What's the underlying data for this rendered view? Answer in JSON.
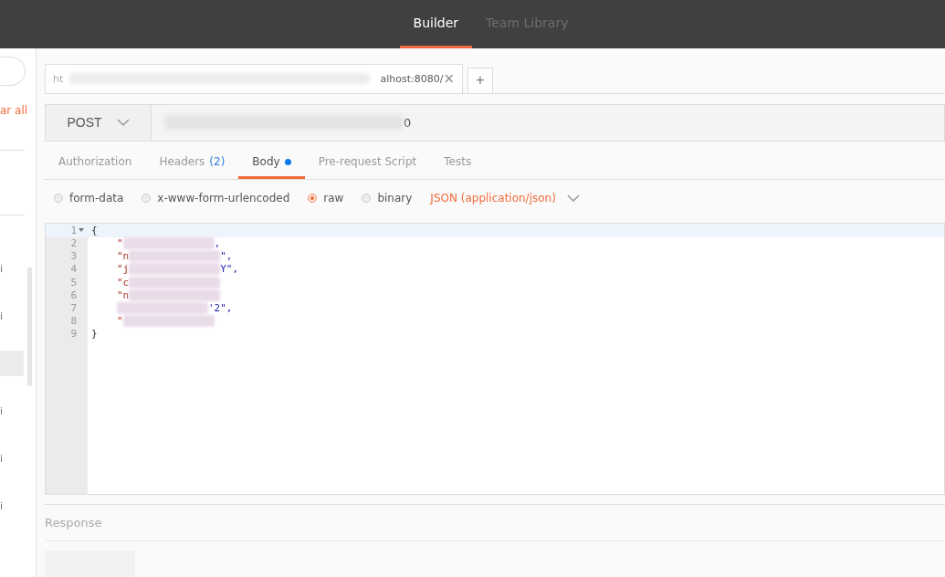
{
  "header": {
    "tabs": [
      {
        "label": "Builder",
        "selected": true
      },
      {
        "label": "Team Library",
        "selected": false
      }
    ]
  },
  "sidebar": {
    "clear_link": "ar all",
    "items": [
      {
        "label": "i",
        "selected": false
      },
      {
        "label": "i",
        "selected": false
      },
      {
        "selected": true
      },
      {
        "label": "i",
        "selected": false
      },
      {
        "label": "i",
        "selected": false
      },
      {
        "label": "i",
        "selected": false
      }
    ]
  },
  "request_tabs": [
    {
      "head": "ht",
      "tail": "alhost:8080/",
      "close": "×",
      "selected": true
    }
  ],
  "new_tab": "+",
  "request": {
    "method": "POST",
    "url_tail": "0"
  },
  "sub_tabs": [
    {
      "label": "Authorization",
      "selected": false
    },
    {
      "label": "Headers",
      "count": "(2)",
      "selected": false
    },
    {
      "label": "Body",
      "dot": true,
      "selected": true
    },
    {
      "label": "Pre-request Script",
      "selected": false
    },
    {
      "label": "Tests",
      "selected": false
    }
  ],
  "body_modes": [
    {
      "label": "form-data",
      "selected": false
    },
    {
      "label": "x-www-form-urlencoded",
      "selected": false
    },
    {
      "label": "raw",
      "selected": true
    },
    {
      "label": "binary",
      "selected": false
    }
  ],
  "content_type": "JSON (application/json)",
  "editor": {
    "lines": [
      {
        "number": "1",
        "head": "{",
        "kind": "plain",
        "foldable": true,
        "active": true
      },
      {
        "number": "2",
        "head": "\"",
        "tail": ",",
        "kind": "redacted",
        "foldable": false,
        "active": false
      },
      {
        "number": "3",
        "head": "\"n",
        "tail": "\",",
        "kind": "redacted",
        "foldable": false,
        "active": false
      },
      {
        "number": "4",
        "head": "\"j",
        "tail": "Y\",",
        "kind": "redacted",
        "foldable": false,
        "active": false
      },
      {
        "number": "5",
        "head": "\"c",
        "kind": "redacted",
        "foldable": false,
        "active": false
      },
      {
        "number": "6",
        "head": "\"n",
        "kind": "redacted",
        "foldable": false,
        "active": false
      },
      {
        "number": "7",
        "tail": "'2\",",
        "kind": "redacted",
        "foldable": false,
        "active": false
      },
      {
        "number": "8",
        "head": "\"",
        "kind": "redacted",
        "foldable": false,
        "active": false
      },
      {
        "number": "9",
        "head": "}",
        "kind": "plain",
        "foldable": false,
        "active": false
      }
    ]
  },
  "response": {
    "title": "Response"
  }
}
